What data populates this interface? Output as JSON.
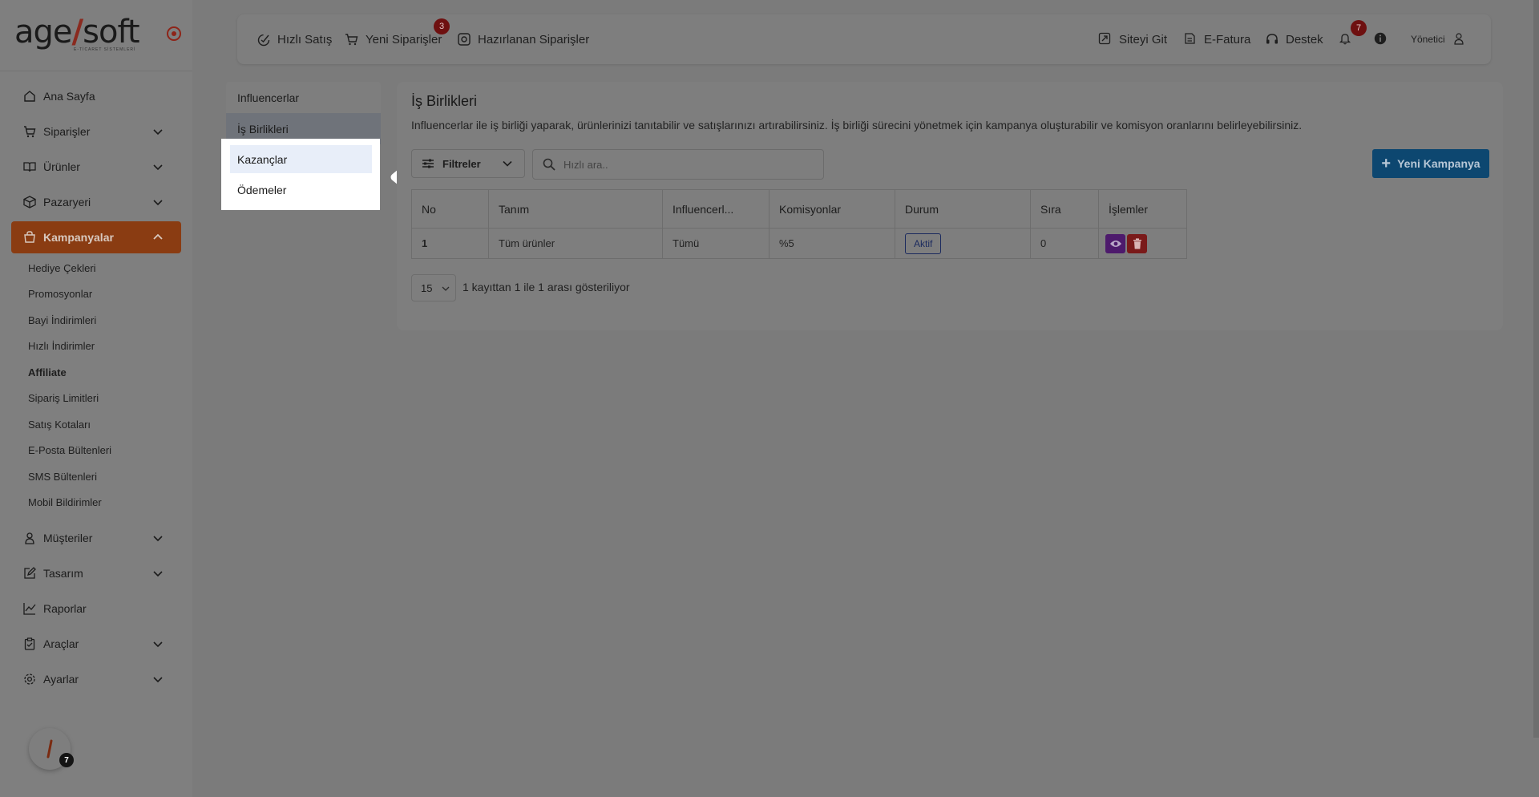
{
  "brand": {
    "logo_main": "age",
    "logo_slash": "/",
    "logo_tail": "soft",
    "logo_sub": "E-TİCARET SİSTEMLERİ"
  },
  "sidebar": {
    "items": [
      {
        "label": "Ana Sayfa",
        "icon": "home-icon",
        "chevron": false
      },
      {
        "label": "Siparişler",
        "icon": "cart-icon",
        "chevron": true
      },
      {
        "label": "Ürünler",
        "icon": "book-icon",
        "chevron": true
      },
      {
        "label": "Pazaryeri",
        "icon": "box-icon",
        "chevron": true
      },
      {
        "label": "Kampanyalar",
        "icon": "basket-icon",
        "chevron": true,
        "active": true
      }
    ],
    "subitems": [
      "Hediye Çekleri",
      "Promosyonlar",
      "Bayi İndirimleri",
      "Hızlı İndirimler",
      "Affiliate",
      "Sipariş Limitleri",
      "Satış Kotaları",
      "E-Posta Bültenleri",
      "SMS Bültenleri",
      "Mobil Bildirimler"
    ],
    "active_sub": "Affiliate",
    "items_bottom": [
      {
        "label": "Müşteriler",
        "icon": "user-icon",
        "chevron": true
      },
      {
        "label": "Tasarım",
        "icon": "edit-icon",
        "chevron": true
      },
      {
        "label": "Raporlar",
        "icon": "chart-icon",
        "chevron": false
      },
      {
        "label": "Araçlar",
        "icon": "clipboard-icon",
        "chevron": true
      },
      {
        "label": "Ayarlar",
        "icon": "gear-icon",
        "chevron": true
      }
    ],
    "fab_badge": "7"
  },
  "topbar": {
    "quick_sale": "Hızlı Satış",
    "new_orders": "Yeni Siparişler",
    "new_orders_badge": "3",
    "prepared_orders": "Hazırlanan Siparişler",
    "go_site": "Siteyi Git",
    "einvoice": "E-Fatura",
    "support": "Destek",
    "notif_badge": "7",
    "user": "Yönetici"
  },
  "submenu": {
    "items": [
      "Influencerlar",
      "İş Birlikleri"
    ],
    "popup_items": [
      "Kazançlar",
      "Ödemeler"
    ]
  },
  "main": {
    "title": "İş Birlikleri",
    "description": "Influencerlar ile iş birliği yaparak, ürünlerinizi tanıtabilir ve satışlarınızı artırabilirsiniz. İş birliği sürecini yönetmek için kampanya oluşturabilir ve komisyon oranlarını belirleyebilirsiniz.",
    "filter_label": "Filtreler",
    "search_placeholder": "Hızlı ara..",
    "new_button": "Yeni Kampanya",
    "table": {
      "columns": [
        "No",
        "Tanım",
        "Influencerl...",
        "Komisyonlar",
        "Durum",
        "Sıra",
        "İşlemler"
      ],
      "rows": [
        {
          "no": "1",
          "tanim": "Tüm ürünler",
          "influencer": "Tümü",
          "komisyon": "%5",
          "durum": "Aktif",
          "sira": "0"
        }
      ]
    },
    "page_size": "15",
    "page_info": "1 kayıttan 1 ile 1 arası gösteriliyor"
  },
  "colors": {
    "accent": "#8a3c12",
    "primary_button": "#0d4770",
    "view_button": "#4d1a6c",
    "delete_button": "#7a1a1a",
    "badge": "#6e1010"
  }
}
